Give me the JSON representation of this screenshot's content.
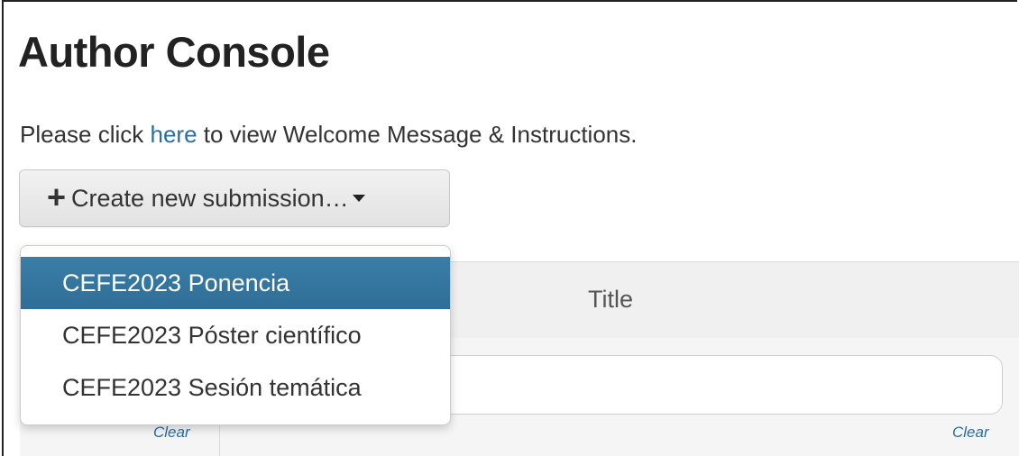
{
  "page": {
    "title": "Author Console",
    "intro_before": "Please click ",
    "intro_link": "here",
    "intro_after": " to view Welcome Message & Instructions."
  },
  "create_button": {
    "plus": "+",
    "label": "Create new submission…"
  },
  "dropdown": {
    "items": [
      {
        "label": "CEFE2023 Ponencia",
        "active": true
      },
      {
        "label": "CEFE2023 Póster científico",
        "active": false
      },
      {
        "label": "CEFE2023 Sesión temática",
        "active": false
      }
    ]
  },
  "table": {
    "title_header": "Title",
    "clear_label_1": "Clear",
    "clear_label_2": "Clear"
  },
  "colors": {
    "link": "#2a6ea0",
    "menu_active_bg": "#2f6e97"
  }
}
